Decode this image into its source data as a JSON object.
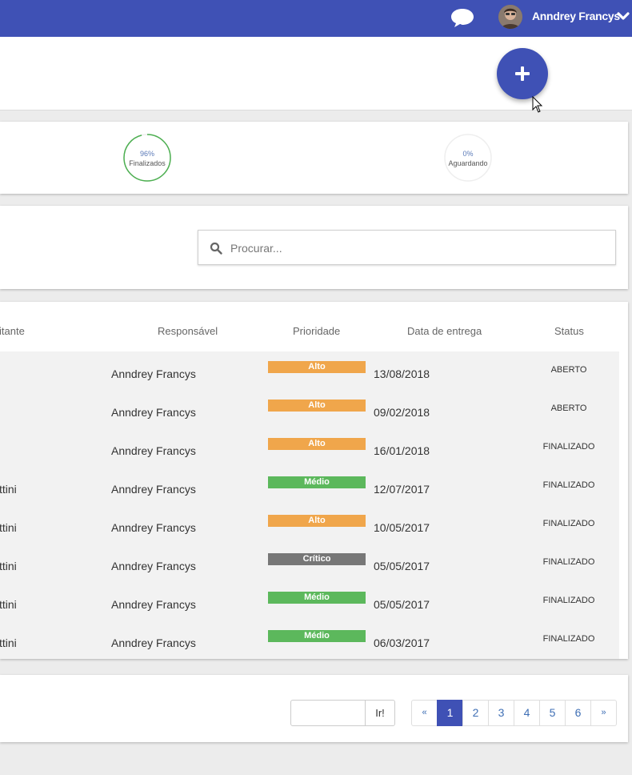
{
  "topbar": {
    "user_name": "Anndrey Francys",
    "icons": {
      "chat": "chat-bubble-icon",
      "avatar": "user-avatar",
      "dropdown": "chevron-down-icon"
    }
  },
  "fab": {
    "icon": "plus-icon"
  },
  "stats": [
    {
      "percent": "96%",
      "label": "Finalizados",
      "value": 0.96,
      "color": "#4caf50"
    },
    {
      "percent": "0%",
      "label": "Aguardando",
      "value": 0.0,
      "color": "#4caf50"
    }
  ],
  "search": {
    "placeholder": "Procurar...",
    "icon": "search-icon"
  },
  "table": {
    "headers": {
      "solicitante": "itante",
      "responsavel": "Responsável",
      "prioridade": "Prioridade",
      "data": "Data de entrega",
      "status": "Status"
    },
    "rows": [
      {
        "solicitante": "",
        "responsavel": "Anndrey Francys",
        "prioridade": "Alto",
        "data": "13/08/2018",
        "status": "ABERTO"
      },
      {
        "solicitante": "",
        "responsavel": "Anndrey Francys",
        "prioridade": "Alto",
        "data": "09/02/2018",
        "status": "ABERTO"
      },
      {
        "solicitante": "",
        "responsavel": "Anndrey Francys",
        "prioridade": "Alto",
        "data": "16/01/2018",
        "status": "FINALIZADO"
      },
      {
        "solicitante": "ttini",
        "responsavel": "Anndrey Francys",
        "prioridade": "Médio",
        "data": "12/07/2017",
        "status": "FINALIZADO"
      },
      {
        "solicitante": "ttini",
        "responsavel": "Anndrey Francys",
        "prioridade": "Alto",
        "data": "10/05/2017",
        "status": "FINALIZADO"
      },
      {
        "solicitante": "ttini",
        "responsavel": "Anndrey Francys",
        "prioridade": "Crítico",
        "data": "05/05/2017",
        "status": "FINALIZADO"
      },
      {
        "solicitante": "ttini",
        "responsavel": "Anndrey Francys",
        "prioridade": "Médio",
        "data": "05/05/2017",
        "status": "FINALIZADO"
      },
      {
        "solicitante": "ttini",
        "responsavel": "Anndrey Francys",
        "prioridade": "Médio",
        "data": "06/03/2017",
        "status": "FINALIZADO"
      }
    ]
  },
  "priority_colors": {
    "Alto": "#f0a64b",
    "Médio": "#5cb85c",
    "Crítico": "#777777"
  },
  "pagination": {
    "goto_label": "Ir!",
    "prev": "«",
    "next": "»",
    "pages": [
      "1",
      "2",
      "3",
      "4",
      "5",
      "6"
    ],
    "current": "1"
  }
}
